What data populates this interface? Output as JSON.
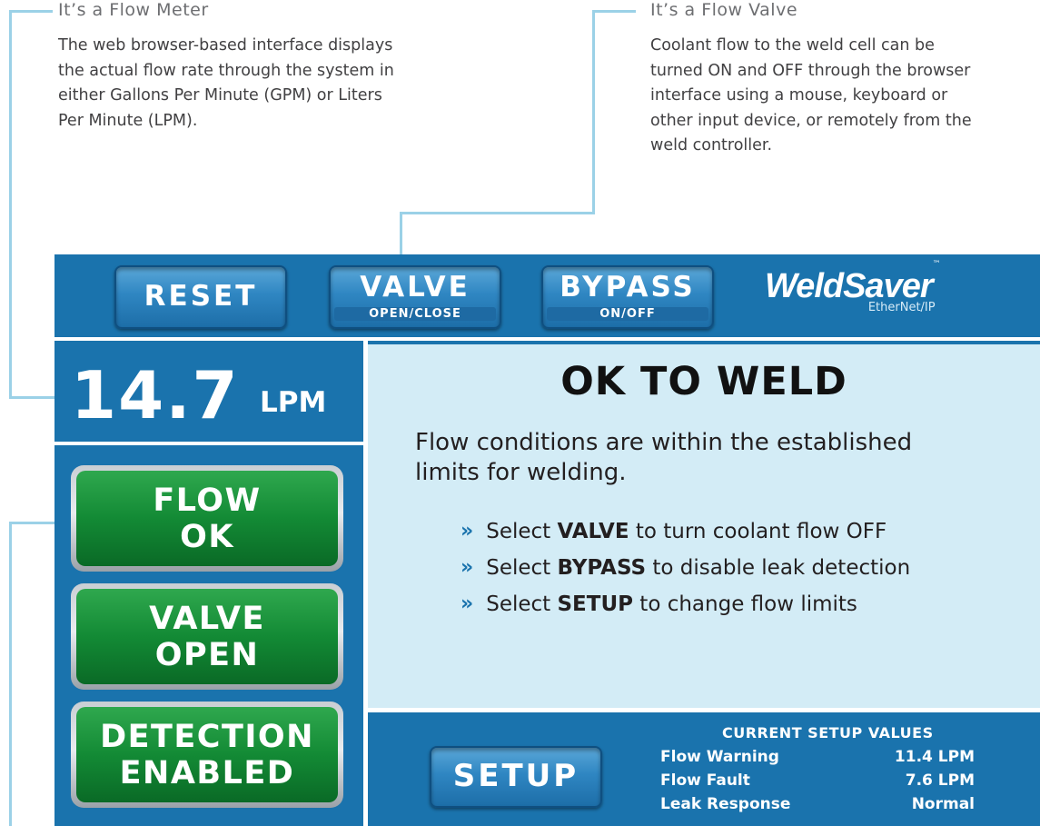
{
  "callouts": {
    "meter": {
      "title": "It’s a Flow Meter",
      "lines": [
        "The web browser-based interface displays",
        "the actual flow rate through the system in",
        "either Gallons Per Minute (GPM) or Liters",
        "Per Minute (LPM)."
      ]
    },
    "valve": {
      "title": "It’s a Flow Valve",
      "lines": [
        "Coolant flow to the weld cell can be",
        "turned ON and OFF through the browser",
        "interface using a mouse, keyboard or",
        "other input device, or remotely from the",
        "weld controller."
      ]
    }
  },
  "toolbar": {
    "reset_label": "RESET",
    "valve_label": "VALVE",
    "valve_sub": "OPEN/CLOSE",
    "bypass_label": "BYPASS",
    "bypass_sub": "ON/OFF"
  },
  "brand": {
    "name": "WeldSaver",
    "tm": "™",
    "sub": "EtherNet/IP"
  },
  "readout": {
    "value": "14.7",
    "unit": "LPM"
  },
  "status_buttons": {
    "flow": [
      "FLOW",
      "OK"
    ],
    "valve": [
      "VALVE",
      "OPEN"
    ],
    "detection": [
      "DETECTION",
      "ENABLED"
    ]
  },
  "message": {
    "title": "OK TO WELD",
    "body_lines": [
      "Flow conditions are within the established",
      "limits for welding."
    ],
    "chevron": "»",
    "bullets": [
      {
        "pre": "Select ",
        "bold": "VALVE",
        "post": " to turn coolant flow OFF"
      },
      {
        "pre": "Select ",
        "bold": "BYPASS",
        "post": " to disable leak detection"
      },
      {
        "pre": "Select ",
        "bold": "SETUP",
        "post": " to change flow limits"
      }
    ]
  },
  "setup": {
    "button_label": "SETUP",
    "values_title": "CURRENT SETUP VALUES",
    "rows": [
      {
        "label": "Flow Warning",
        "value": "11.4 LPM"
      },
      {
        "label": "Flow Fault",
        "value": "7.6 LPM"
      },
      {
        "label": "Leak Response",
        "value": "Normal"
      }
    ]
  },
  "colors": {
    "panel_blue": "#1a73ad",
    "message_bg": "#d3ecf6",
    "status_green": "#138a35",
    "callout_line": "#9bd1e7"
  }
}
